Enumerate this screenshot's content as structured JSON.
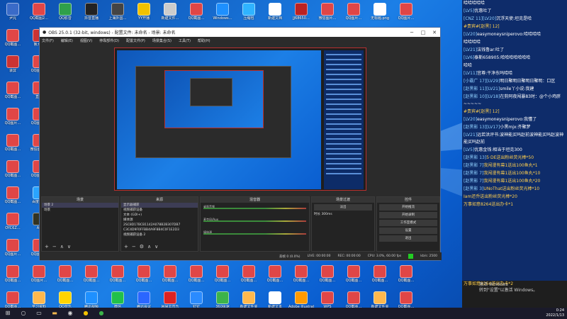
{
  "desktop_icons": [
    {
      "label": "尹咒",
      "col": 0,
      "row": 0,
      "color": "#3a6bc8"
    },
    {
      "label": "QQ截图2…",
      "col": 1,
      "row": 0,
      "color": "#e04646"
    },
    {
      "label": "QQ影音",
      "col": 2,
      "row": 0,
      "color": "#2fa04a"
    },
    {
      "label": "抖音直播",
      "col": 3,
      "row": 0,
      "color": "#222"
    },
    {
      "label": "上海外国…",
      "col": 4,
      "row": 0,
      "color": "#444"
    },
    {
      "label": "YY开播",
      "col": 5,
      "row": 0,
      "color": "#f2c200"
    },
    {
      "label": "新建文件…",
      "col": 6,
      "row": 0,
      "color": "#ccc"
    },
    {
      "label": "QQ截图…",
      "col": 7,
      "row": 0,
      "color": "#e04646"
    },
    {
      "label": "Windows…",
      "col": 8,
      "row": 0,
      "color": "#1e90ff"
    },
    {
      "label": "压缩包",
      "col": 9,
      "row": 0,
      "color": "#2fb3ff"
    },
    {
      "label": "新建文档",
      "col": 10,
      "row": 0,
      "color": "#fff"
    },
    {
      "label": "JJ68650…",
      "col": 11,
      "row": 0,
      "color": "#b22"
    },
    {
      "label": "微信图片…",
      "col": 12,
      "row": 0,
      "color": "#e04646"
    },
    {
      "label": "QQ图片…",
      "col": 13,
      "row": 0,
      "color": "#e04646"
    },
    {
      "label": "无标题.png",
      "col": 14,
      "row": 0,
      "color": "#fff"
    },
    {
      "label": "QQ图片…",
      "col": 15,
      "row": 0,
      "color": "#e04646"
    },
    {
      "label": "QQ截图…",
      "col": 0,
      "row": 1,
      "color": "#e04646"
    },
    {
      "label": "鲁大师",
      "col": 1,
      "row": 1,
      "color": "#c33"
    },
    {
      "label": "录屏",
      "col": 0,
      "row": 2,
      "color": "#c33"
    },
    {
      "label": "QQ图片…",
      "col": 1,
      "row": 2,
      "color": "#e04646"
    },
    {
      "label": "QQ截图…",
      "col": 0,
      "row": 3,
      "color": "#e04646"
    },
    {
      "label": "直播",
      "col": 1,
      "row": 3,
      "color": "#e04646"
    },
    {
      "label": "QQ图片…",
      "col": 0,
      "row": 4,
      "color": "#e04646"
    },
    {
      "label": "QQ图片…",
      "col": 1,
      "row": 4,
      "color": "#e04646"
    },
    {
      "label": "QQ截图…",
      "col": 0,
      "row": 5,
      "color": "#e04646"
    },
    {
      "label": "微信图片…",
      "col": 1,
      "row": 5,
      "color": "#e04646"
    },
    {
      "label": "QQ截图…",
      "col": 0,
      "row": 6,
      "color": "#e04646"
    },
    {
      "label": "QQ图片…",
      "col": 1,
      "row": 6,
      "color": "#e04646"
    },
    {
      "label": "QQ截图…",
      "col": 0,
      "row": 7,
      "color": "#e04646"
    },
    {
      "label": "百度网盘",
      "col": 1,
      "row": 7,
      "color": "#2aa4ff"
    },
    {
      "label": "OYC6Z…",
      "col": 0,
      "row": 8,
      "color": "#e04646"
    },
    {
      "label": "AE",
      "col": 1,
      "row": 8,
      "color": "#332"
    },
    {
      "label": "QQ图片…",
      "col": 0,
      "row": 9,
      "color": "#e04646"
    },
    {
      "label": "QQ图片…",
      "col": 1,
      "row": 9,
      "color": "#e04646"
    },
    {
      "label": "QQ截图…",
      "col": 0,
      "row": 10,
      "color": "#e04646"
    },
    {
      "label": "QQ图片…",
      "col": 1,
      "row": 10,
      "color": "#e04646"
    },
    {
      "label": "QQ截图…",
      "col": 2,
      "row": 10,
      "color": "#e04646"
    },
    {
      "label": "QQ截图…",
      "col": 3,
      "row": 10,
      "color": "#e04646"
    },
    {
      "label": "QQ截图…",
      "col": 4,
      "row": 10,
      "color": "#e04646"
    },
    {
      "label": "QQ截图…",
      "col": 5,
      "row": 10,
      "color": "#e04646"
    },
    {
      "label": "QQ截图…",
      "col": 6,
      "row": 10,
      "color": "#e04646"
    },
    {
      "label": "QQ截图…",
      "col": 7,
      "row": 10,
      "color": "#e04646"
    },
    {
      "label": "QQ截图…",
      "col": 8,
      "row": 10,
      "color": "#e04646"
    },
    {
      "label": "QQ截图…",
      "col": 9,
      "row": 10,
      "color": "#e04646"
    },
    {
      "label": "QQ截图…",
      "col": 10,
      "row": 10,
      "color": "#e04646"
    },
    {
      "label": "QQ截图…",
      "col": 11,
      "row": 10,
      "color": "#e04646"
    },
    {
      "label": "QQ截图…",
      "col": 12,
      "row": 10,
      "color": "#e04646"
    },
    {
      "label": "QQ截图…",
      "col": 13,
      "row": 10,
      "color": "#e04646"
    },
    {
      "label": "QQ截图…",
      "col": 14,
      "row": 10,
      "color": "#e04646"
    },
    {
      "label": "QQ截图…",
      "col": 15,
      "row": 10,
      "color": "#e04646"
    },
    {
      "label": "QQ截图…",
      "col": 0,
      "row": 11,
      "color": "#e04646"
    },
    {
      "label": "学习资料",
      "col": 1,
      "row": 11,
      "color": "#ffb84d"
    },
    {
      "label": "QQ音乐",
      "col": 2,
      "row": 11,
      "color": "#ffd400"
    },
    {
      "label": "腾讯视频",
      "col": 3,
      "row": 11,
      "color": "#1e90ff"
    },
    {
      "label": "微信",
      "col": 4,
      "row": 11,
      "color": "#21c04a"
    },
    {
      "label": "腾讯会议",
      "col": 5,
      "row": 11,
      "color": "#2a66ff"
    },
    {
      "label": "网易云音乐",
      "col": 6,
      "row": 11,
      "color": "#d22"
    },
    {
      "label": "钉钉",
      "col": 7,
      "row": 11,
      "color": "#2a8bff"
    },
    {
      "label": "360极速",
      "col": 8,
      "row": 11,
      "color": "#3cb34a"
    },
    {
      "label": "新建文件夹",
      "col": 9,
      "row": 11,
      "color": "#ffb84d"
    },
    {
      "label": "新建文本",
      "col": 10,
      "row": 11,
      "color": "#fff"
    },
    {
      "label": "Adobe Illustrator",
      "col": 11,
      "row": 11,
      "color": "#ff9a00"
    },
    {
      "label": "WPS",
      "col": 12,
      "row": 11,
      "color": "#e04646"
    },
    {
      "label": "QQ截图…",
      "col": 13,
      "row": 11,
      "color": "#e04646"
    },
    {
      "label": "新建文件夹",
      "col": 14,
      "row": 11,
      "color": "#ffb84d"
    },
    {
      "label": "QQ截图…",
      "col": 15,
      "row": 11,
      "color": "#e04646"
    }
  ],
  "obs": {
    "title": "OBS 25.0.1 (32-bit, windows) - 配置文件: 未命名 - 场景: 未命名",
    "menu": [
      "文件(F)",
      "编辑(E)",
      "视图(V)",
      "停靠部件(D)",
      "配置文件(P)",
      "场景集合(S)",
      "工具(T)",
      "帮助(H)"
    ],
    "scenes_title": "场景",
    "scenes": [
      "场景 2",
      "场景"
    ],
    "sources_title": "来源",
    "sources": [
      "显示器捕获",
      "视频捕获设备",
      "文本 (GDI+)",
      "媒体源",
      "2SC8D17BCB1142A078B2B307DB7",
      "C3C4D9F0FFBB4A9F8B4C0F1E2D3",
      "视频捕获设备 2"
    ],
    "mixer_title": "混音器",
    "mixer": [
      "桌面音频",
      "麦克风/Aux",
      "媒体源"
    ],
    "transitions_title": "场景过渡",
    "transition_type": "淡出",
    "duration_label": "时长",
    "duration_value": "300ms",
    "controls_title": "控件",
    "controls": [
      "开始推流",
      "开始录制",
      "工作室模式",
      "设置",
      "退出"
    ],
    "status": {
      "dropped": "丢帧 0 (0.0%)",
      "live": "LIVE: 00:00:00",
      "rec": "REC: 00:00:00",
      "cpu": "CPU: 3.0%, 60.00 fps",
      "kbps": "kb/s: 2500"
    }
  },
  "chat": [
    {
      "lvl": "",
      "name": "",
      "text": "哈哈哈哈哈",
      "type": "n"
    },
    {
      "lvl": "[LV5]",
      "name": "优惠",
      "text": "吐了",
      "type": "n"
    },
    {
      "lvl": "[CNZ 11][LV20]",
      "name": "沉浮天使:",
      "text": "坦克是哈",
      "type": "n"
    },
    {
      "lvl": "",
      "name": "",
      "text": "#贵宾#[赵黑] 12]",
      "type": "g"
    },
    {
      "lvl": "[LV20]",
      "name": "easymoneysniperovo:",
      "text": "哈哈哈哈",
      "type": "n"
    },
    {
      "lvl": "",
      "name": "",
      "text": "哈哈哈哈",
      "type": "n"
    },
    {
      "lvl": "[LV21]",
      "name": "法钱鲁ar:",
      "text": "吐了",
      "type": "n"
    },
    {
      "lvl": "[LV6]",
      "name": "泰斯658905:",
      "text": "哈哈哈哈哈哈哈",
      "type": "n"
    },
    {
      "lvl": "",
      "name": "",
      "text": "哈哈",
      "type": "n"
    },
    {
      "lvl": "[LV11]",
      "name": "宫尊:",
      "text": "干净东吗哈哈",
      "type": "n"
    },
    {
      "lvl": "[小霸广 17][LV29]",
      "name": "",
      "text": "明日聚明日聚明日聚明：口区",
      "type": "n"
    },
    {
      "lvl": "[赵黑影 11][LV21]",
      "name": "smile丫小说:",
      "text": "我建",
      "type": "n"
    },
    {
      "lvl": "[赵黑影 10][LV18]",
      "name": "在剪阿夜闯暴83",
      "text": "时：@个小鸡胖~~~~~",
      "type": "n"
    },
    {
      "lvl": "",
      "name": "",
      "text": "#贵宾#[赵黑] 12]",
      "type": "g"
    },
    {
      "lvl": "[LV20]",
      "name": "easymoneysniperovo:",
      "text": "我懂了",
      "type": "n"
    },
    {
      "lvl": "[赵黑影 13][LV17]",
      "name": "小黑mjx:",
      "text": "齐聚梦",
      "type": "n"
    },
    {
      "lvl": "[LV21]",
      "name": "远若洪评书:",
      "text": "波神能买吗赵前波神能买吗赵波神能买吗赵前",
      "type": "n"
    },
    {
      "lvl": "[LV5]",
      "name": "优惠金钱:",
      "text": "相当于坦克300",
      "type": "n"
    },
    {
      "lvl": "[赵黑影 13]",
      "name": "5·DE",
      "text": "送出粉丝荧光棒*50",
      "type": "g"
    },
    {
      "lvl": "[赵黑影 7]",
      "name": "我闯漫有幕1",
      "text": "送出100鱼丸*1",
      "type": "g"
    },
    {
      "lvl": "[赵黑影 7]",
      "name": "我闯漫有幕1",
      "text": "送出100鱼丸*10",
      "type": "g"
    },
    {
      "lvl": "[赵黑影 7]",
      "name": "我闯漫有幕1",
      "text": "送出100鱼丸*20",
      "type": "g"
    },
    {
      "lvl": "[赵黑影 3]",
      "name": "UNoThat",
      "text": "送出粉丝荧光棒*10",
      "type": "g"
    },
    {
      "lvl": "",
      "name": "Iam还乔",
      "text": "送出粉丝荧光棒*20",
      "type": "g"
    },
    {
      "lvl": "",
      "name": "万事如意8264",
      "text": "送出办卡*1",
      "type": "g"
    }
  ],
  "chat_footer": "万事如意8264送出办卡*2",
  "activate": {
    "line1": "激活 Windows",
    "line2": "转到\"设置\"以激活 Windows。"
  },
  "taskbar": {
    "time": "0:24",
    "date": "2022/1/13"
  }
}
